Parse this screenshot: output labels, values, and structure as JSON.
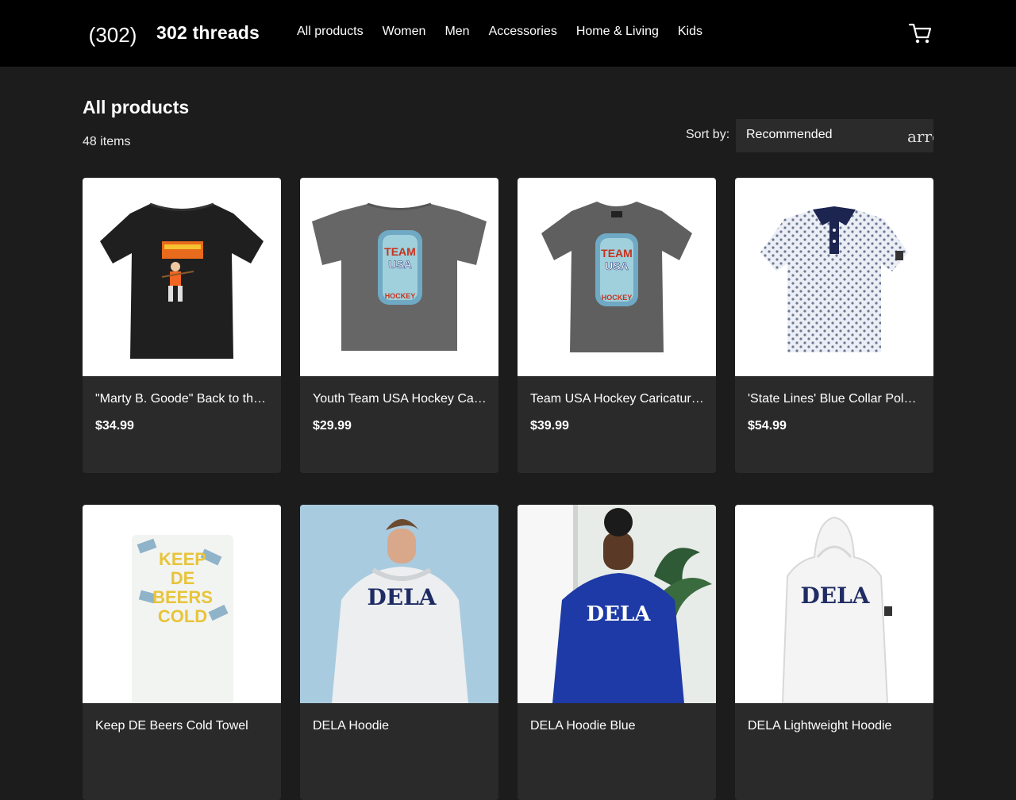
{
  "header": {
    "logo_text": "(302)",
    "brand": "302 threads",
    "nav": [
      "All products",
      "Women",
      "Men",
      "Accessories",
      "Home & Living",
      "Kids"
    ],
    "cart_icon": "cart-icon"
  },
  "main": {
    "title": "All products",
    "count": "48 items",
    "sort_label": "Sort by:",
    "sort_value": "Recommended",
    "sort_arrow_text": "arrow"
  },
  "products": [
    {
      "name": "\"Marty B. Goode\" Back to the Future Parody T-Shirt",
      "price": "$34.99"
    },
    {
      "name": "Youth Team USA Hockey Caricature Tee",
      "price": "$29.99"
    },
    {
      "name": "Team USA Hockey Caricature Tee",
      "price": "$39.99"
    },
    {
      "name": "'State Lines' Blue Collar Polo Shirt",
      "price": "$54.99"
    },
    {
      "name": "Keep DE Beers Cold Towel",
      "price": ""
    },
    {
      "name": "DELA Hoodie",
      "price": ""
    },
    {
      "name": "DELA Hoodie Blue",
      "price": ""
    },
    {
      "name": "DELA Lightweight Hoodie",
      "price": ""
    }
  ],
  "artwork": {
    "team_usa": [
      "TEAM",
      "USA",
      "HOCKEY"
    ],
    "keep_cold": [
      "KEEP",
      "DE",
      "BEERS",
      "COLD"
    ],
    "dela": "DELA"
  }
}
